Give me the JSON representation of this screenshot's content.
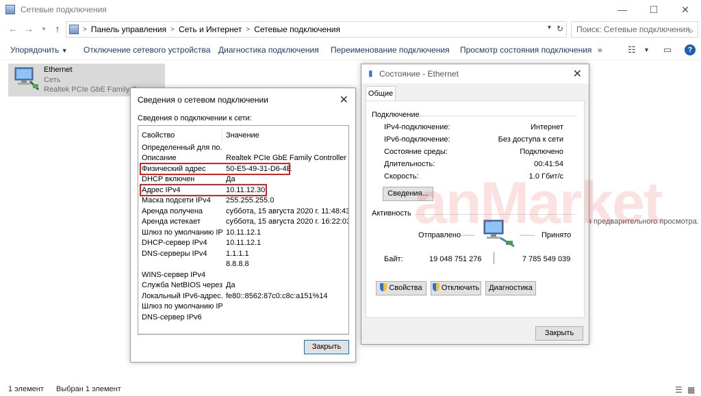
{
  "window": {
    "title": "Сетевые подключения",
    "controls": [
      "—",
      "☐",
      "✕"
    ]
  },
  "address": {
    "breadcrumbs": [
      "Панель управления",
      "Сеть и Интернет",
      "Сетевые подключения"
    ],
    "search_placeholder": "Поиск: Сетевые подключения"
  },
  "toolbar": {
    "organize": "Упорядочить",
    "disable": "Отключение сетевого устройства",
    "diagnose": "Диагностика подключения",
    "rename": "Переименование подключения",
    "view_status": "Просмотр состояния подключения",
    "more": "»"
  },
  "network_item": {
    "name": "Ethernet",
    "network": "Сеть",
    "adapter": "Realtek PCIe GbE Family Co..."
  },
  "preview_text": "я предварительного просмотра.",
  "statusbar": {
    "count": "1 элемент",
    "selected": "Выбран 1 элемент"
  },
  "watermark": "anMarket",
  "status_dialog": {
    "title": "Состояние - Ethernet",
    "tab": "Общие",
    "connection_group": "Подключение",
    "rows": [
      {
        "label": "IPv4-подключение:",
        "value": "Интернет"
      },
      {
        "label": "IPv6-подключение:",
        "value": "Без доступа к сети"
      },
      {
        "label": "Состояние среды:",
        "value": "Подключено"
      },
      {
        "label": "Длительность:",
        "value": "00:41:54"
      },
      {
        "label": "Скорость:",
        "value": "1.0 Гбит/с"
      }
    ],
    "details_button": "Сведения...",
    "activity_group": "Активность",
    "sent_label": "Отправлено",
    "received_label": "Принято",
    "bytes_label": "Байт:",
    "bytes_sent": "19 048 751 276",
    "bytes_received": "7 785 549 039",
    "properties_button": "Свойства",
    "disable_button": "Отключить",
    "diagnose_button": "Диагностика",
    "close_button": "Закрыть"
  },
  "details_dialog": {
    "title": "Сведения о сетевом подключении",
    "subtitle": "Сведения о подключении к сети:",
    "col_property": "Свойство",
    "col_value": "Значение",
    "rows": [
      {
        "p": "Определенный для по...",
        "v": ""
      },
      {
        "p": "Описание",
        "v": "Realtek PCIe GbE Family Controller"
      },
      {
        "p": "Физический адрес",
        "v": "50-E5-49-31-D6-4E"
      },
      {
        "p": "DHCP включен",
        "v": "Да"
      },
      {
        "p": "Адрес IPv4",
        "v": "10.11.12.30"
      },
      {
        "p": "Маска подсети IPv4",
        "v": "255.255.255.0"
      },
      {
        "p": "Аренда получена",
        "v": "суббота, 15 августа 2020 г. 11:48:43"
      },
      {
        "p": "Аренда истекает",
        "v": "суббота, 15 августа 2020 г. 16:22:03"
      },
      {
        "p": "Шлюз по умолчанию IP...",
        "v": "10.11.12.1"
      },
      {
        "p": "DHCP-сервер IPv4",
        "v": "10.11.12.1"
      },
      {
        "p": "DNS-серверы IPv4",
        "v": "1.1.1.1"
      },
      {
        "p": "",
        "v": "8.8.8.8"
      },
      {
        "p": "WINS-сервер IPv4",
        "v": ""
      },
      {
        "p": "Служба NetBIOS через...",
        "v": "Да"
      },
      {
        "p": "Локальный IPv6-адрес...",
        "v": "fe80::8562:87c0:c8c:a151%14"
      },
      {
        "p": "Шлюз по умолчанию IP...",
        "v": ""
      },
      {
        "p": "DNS-сервер IPv6",
        "v": ""
      }
    ],
    "close_button": "Закрыть"
  },
  "colors": {
    "highlight_box": "#d7231f",
    "selection": "#d9d9d9",
    "link_text": "#1e3a6e"
  }
}
